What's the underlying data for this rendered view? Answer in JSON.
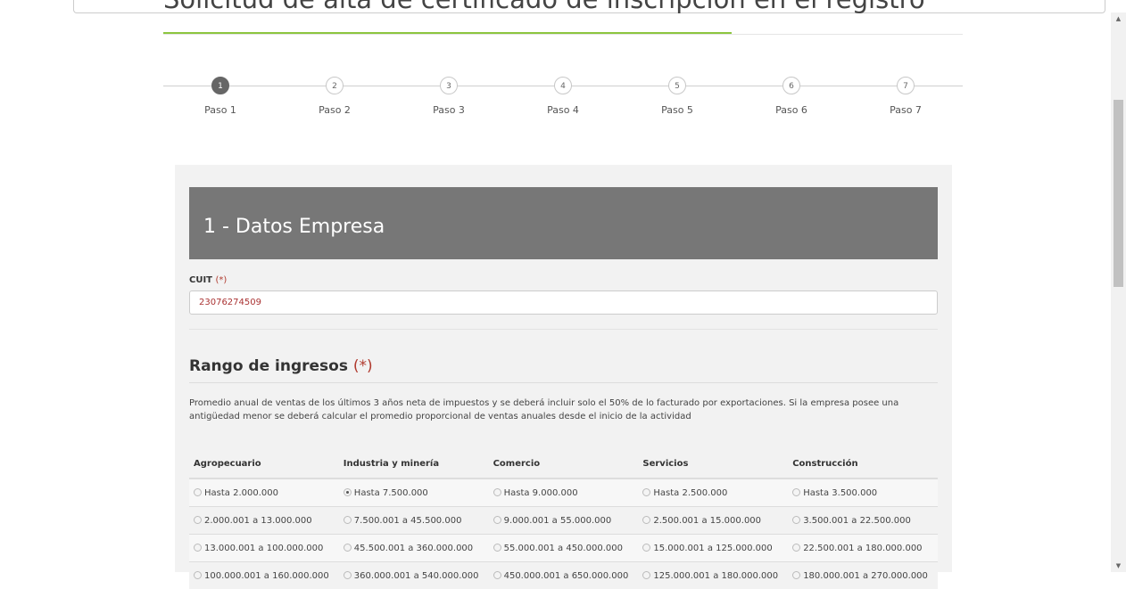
{
  "page": {
    "title": "Solicitud de alta de certificado de inscripción en el registro"
  },
  "stepper": {
    "active": 1,
    "steps": [
      {
        "num": "1",
        "label": "Paso 1"
      },
      {
        "num": "2",
        "label": "Paso 2"
      },
      {
        "num": "3",
        "label": "Paso 3"
      },
      {
        "num": "4",
        "label": "Paso 4"
      },
      {
        "num": "5",
        "label": "Paso 5"
      },
      {
        "num": "6",
        "label": "Paso 6"
      },
      {
        "num": "7",
        "label": "Paso 7"
      }
    ]
  },
  "section": {
    "title": "1 - Datos Empresa"
  },
  "cuit": {
    "label": "CUIT",
    "required_mark": "(*)",
    "value": "23076274509"
  },
  "rango": {
    "title": "Rango de ingresos",
    "required_mark": "(*)",
    "description": "Promedio anual de ventas de los últimos 3 años neta de impuestos y se deberá incluir solo el 50% de lo facturado por exportaciones. Si la empresa posee una antigüedad menor se deberá calcular el promedio proporcional de ventas anuales desde el inicio de la actividad",
    "columns": [
      "Agropecuario",
      "Industria y minería",
      "Comercio",
      "Servicios",
      "Construcción"
    ],
    "rows": [
      [
        "Hasta 2.000.000",
        "Hasta 7.500.000",
        "Hasta 9.000.000",
        "Hasta 2.500.000",
        "Hasta 3.500.000"
      ],
      [
        "2.000.001 a 13.000.000",
        "7.500.001 a 45.500.000",
        "9.000.001 a 55.000.000",
        "2.500.001 a 15.000.000",
        "3.500.001 a 22.500.000"
      ],
      [
        "13.000.001 a 100.000.000",
        "45.500.001 a 360.000.000",
        "55.000.001 a 450.000.000",
        "15.000.001 a 125.000.000",
        "22.500.001 a 180.000.000"
      ],
      [
        "100.000.001 a 160.000.000",
        "360.000.001 a 540.000.000",
        "450.000.001 a 650.000.000",
        "125.000.001 a 180.000.000",
        "180.000.001 a 270.000.000"
      ]
    ],
    "selected": {
      "row": 0,
      "col": 1
    }
  },
  "scrollbar": {
    "up_icon": "▲",
    "down_icon": "▼"
  }
}
